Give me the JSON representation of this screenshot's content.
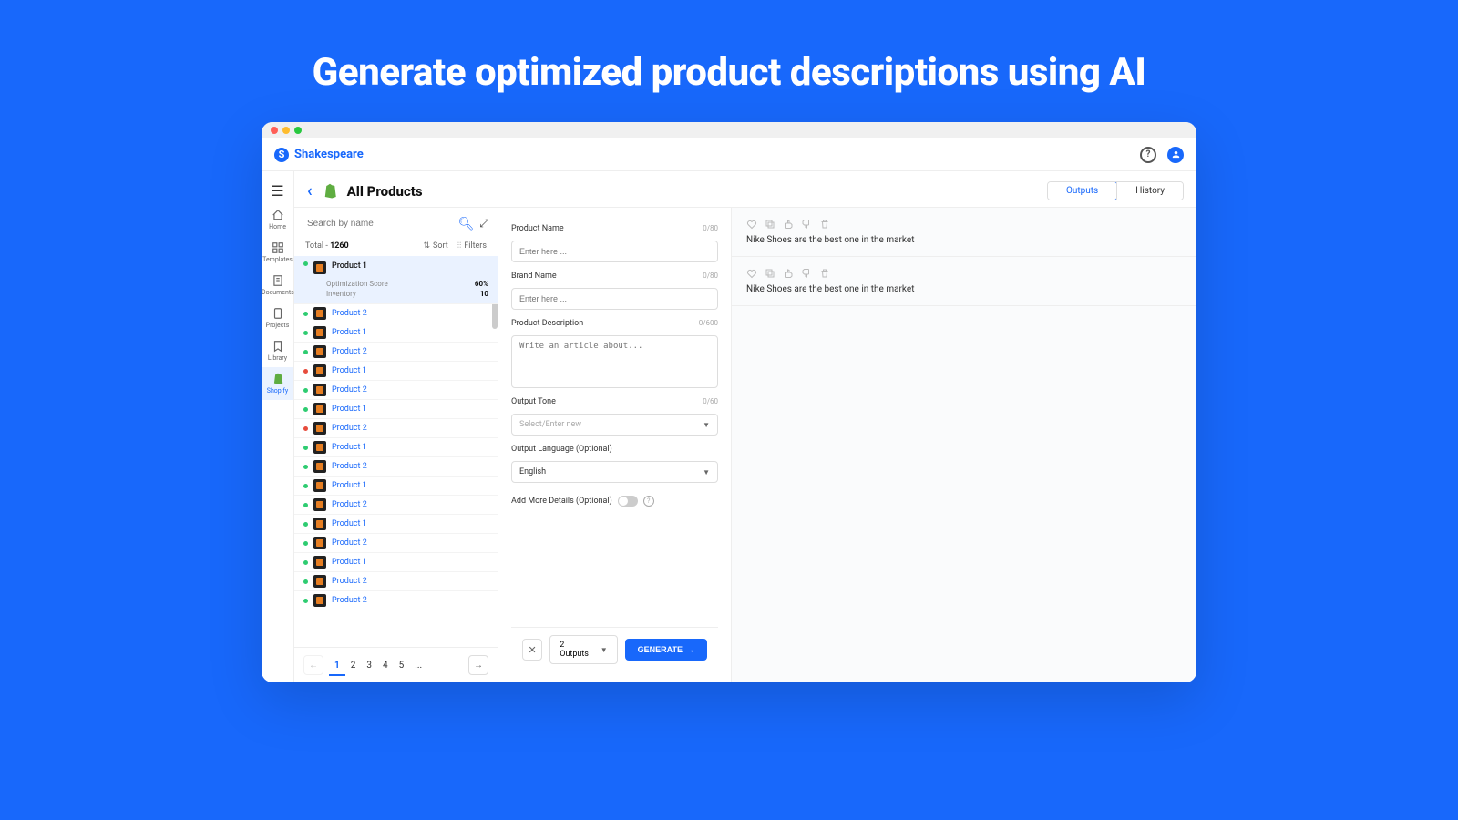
{
  "hero": {
    "title": "Generate optimized product descriptions using AI"
  },
  "brand": {
    "name": "Shakespeare",
    "initial": "S"
  },
  "sidebar": {
    "items": [
      {
        "label": "Home"
      },
      {
        "label": "Templates"
      },
      {
        "label": "Documents"
      },
      {
        "label": "Projects"
      },
      {
        "label": "Library"
      },
      {
        "label": "Shopify"
      }
    ]
  },
  "header": {
    "title": "All Products",
    "tabs": {
      "outputs": "Outputs",
      "history": "History"
    }
  },
  "left": {
    "search_placeholder": "Search by name",
    "total_label": "Total - ",
    "total_value": "1260",
    "sort": "Sort",
    "filters": "Filters",
    "products": [
      {
        "name": "Product 1",
        "status": "green",
        "expanded": true,
        "opt_label": "Optimization Score",
        "opt_val": "60%",
        "inv_label": "Inventory",
        "inv_val": "10"
      },
      {
        "name": "Product 2",
        "status": "green"
      },
      {
        "name": "Product 1",
        "status": "green"
      },
      {
        "name": "Product 2",
        "status": "green"
      },
      {
        "name": "Product 1",
        "status": "red"
      },
      {
        "name": "Product 2",
        "status": "green"
      },
      {
        "name": "Product 1",
        "status": "green"
      },
      {
        "name": "Product 2",
        "status": "red"
      },
      {
        "name": "Product 1",
        "status": "green"
      },
      {
        "name": "Product 2",
        "status": "green"
      },
      {
        "name": "Product 1",
        "status": "green"
      },
      {
        "name": "Product 2",
        "status": "green"
      },
      {
        "name": "Product 1",
        "status": "green"
      },
      {
        "name": "Product 2",
        "status": "green"
      },
      {
        "name": "Product 1",
        "status": "green"
      },
      {
        "name": "Product 2",
        "status": "green"
      },
      {
        "name": "Product 2",
        "status": "green"
      }
    ],
    "pages": [
      "1",
      "2",
      "3",
      "4",
      "5",
      "..."
    ]
  },
  "form": {
    "product_name": {
      "label": "Product Name",
      "placeholder": "Enter here ...",
      "count": "0/80"
    },
    "brand_name": {
      "label": "Brand Name",
      "placeholder": "Enter here ...",
      "count": "0/80"
    },
    "description": {
      "label": "Product Description",
      "placeholder": "Write an article about...",
      "count": "0/600"
    },
    "tone": {
      "label": "Output Tone",
      "placeholder": "Select/Enter new",
      "count": "0/60"
    },
    "language": {
      "label": "Output Language (Optional)",
      "value": "English"
    },
    "details": {
      "label": "Add More Details (Optional)"
    },
    "outputs_count": "2 Outputs",
    "generate": "GENERATE"
  },
  "outputs": [
    {
      "text": "Nike Shoes are the best one in the market"
    },
    {
      "text": "Nike Shoes are the best one in the market"
    }
  ]
}
